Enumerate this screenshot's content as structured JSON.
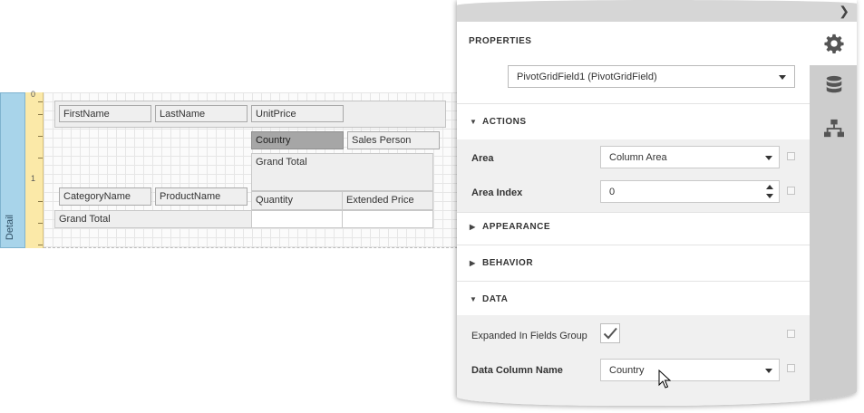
{
  "designer": {
    "band_label": "Detail",
    "ruler_marks": [
      "0",
      "1"
    ],
    "pivot_fields": {
      "first_name": "FirstName",
      "last_name": "LastName",
      "unit_price": "UnitPrice",
      "country": "Country",
      "sales_person": "Sales Person",
      "grand_total_col": "Grand Total",
      "category_name": "CategoryName",
      "product_name": "ProductName",
      "quantity": "Quantity",
      "extended_price": "Extended Price",
      "grand_total_row": "Grand Total"
    }
  },
  "panel": {
    "title": "PROPERTIES",
    "selected_object": "PivotGridField1 (PivotGridField)",
    "collapse_icon": "chevron-right-icon",
    "side_tabs": [
      "gear-icon",
      "database-icon",
      "report-explorer-icon"
    ],
    "sections": {
      "actions": "ACTIONS",
      "appearance": "APPEARANCE",
      "behavior": "BEHAVIOR",
      "data": "DATA"
    },
    "actions": {
      "area_label": "Area",
      "area_value": "Column Area",
      "area_index_label": "Area Index",
      "area_index_value": "0"
    },
    "data": {
      "expanded_label": "Expanded In Fields Group",
      "expanded_checked": true,
      "column_name_label": "Data Column Name",
      "column_name_value": "Country"
    }
  }
}
